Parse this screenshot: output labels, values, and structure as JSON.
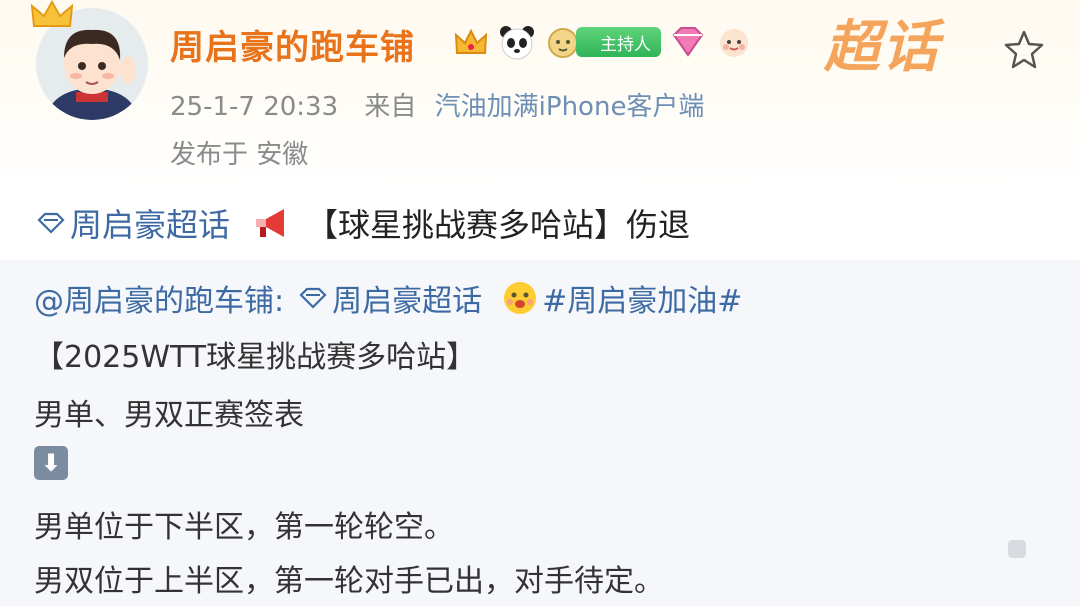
{
  "post": {
    "username": "周启豪的跑车铺",
    "host_badge": "主持人",
    "super_topic_logo": "超话",
    "time": "25-1-7 20:33",
    "source_prefix": "来自",
    "source": "汽油加满iPhone客户端",
    "location": "发布于 安徽",
    "topic": "周启豪超话",
    "text": "【球星挑战赛多哈站】伤退",
    "badge_icons": [
      "crown-icon",
      "panda-icon",
      "sheep-icon",
      "diamond-level-icon",
      "baby-face-icon"
    ]
  },
  "repost": {
    "author_mention": "@周启豪的跑车铺:",
    "topic": "周启豪超话",
    "hashtag": "#周启豪加油#",
    "line2": "【2025WTT球星挑战赛多哈站】",
    "line3": "男单、男双正赛签表",
    "line5": "男单位于下半区，第一轮轮空。",
    "line6": "男双位于上半区，第一轮对手已出，对手待定。"
  },
  "colors": {
    "username": "#e8731a",
    "link": "#3d6aa3",
    "meta": "#8a8a8a",
    "repost_bg": "#f5f7fa"
  }
}
